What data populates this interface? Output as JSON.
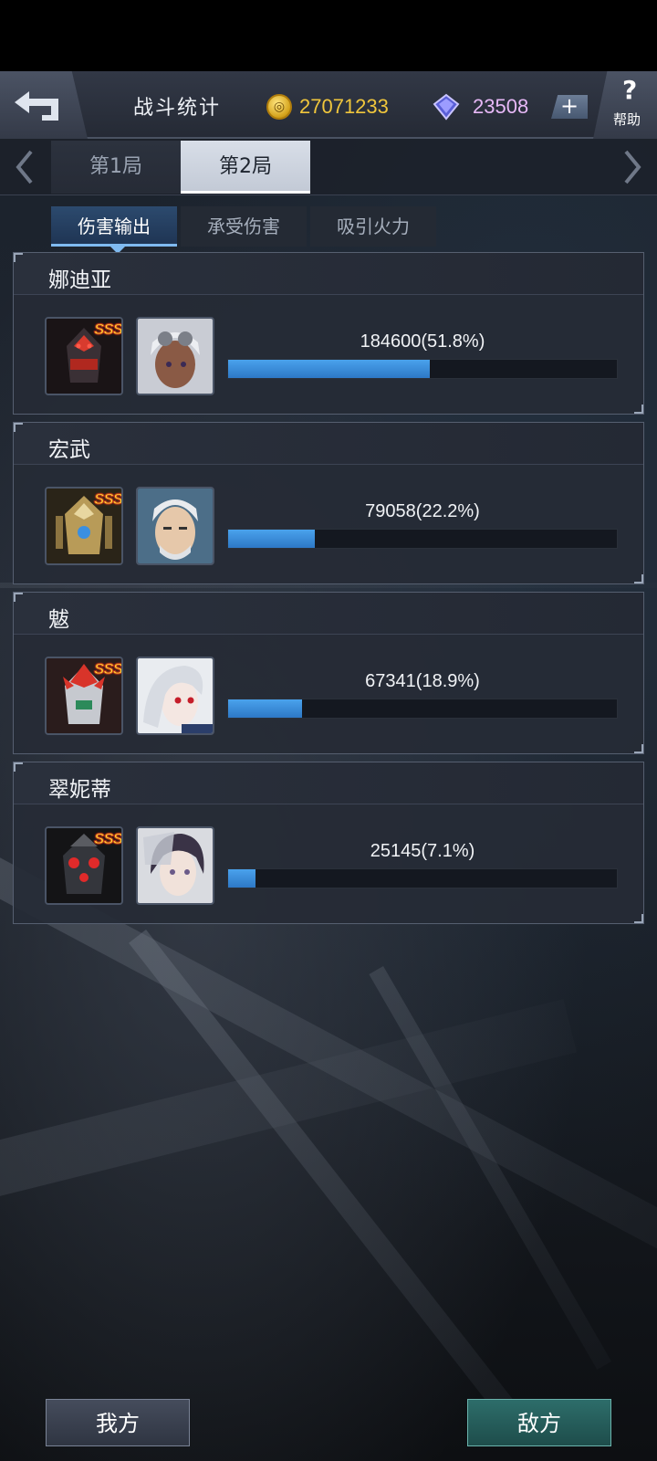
{
  "header": {
    "title": "战斗统计",
    "coins": "27071233",
    "gems": "23508",
    "coin_icon": "coin-icon",
    "gem_icon": "gem-icon",
    "plus_label": "+",
    "help_label": "帮助"
  },
  "round_tabs": [
    {
      "label": "第1局",
      "active": false
    },
    {
      "label": "第2局",
      "active": true
    }
  ],
  "stat_tabs": [
    {
      "label": "伤害输出",
      "active": true
    },
    {
      "label": "承受伤害",
      "active": false
    },
    {
      "label": "吸引火力",
      "active": false
    }
  ],
  "entries": [
    {
      "name": "娜迪亚",
      "rank": "SSS",
      "value_text": "184600(51.8%)",
      "percent": 51.8
    },
    {
      "name": "宏武",
      "rank": "SSS",
      "value_text": "79058(22.2%)",
      "percent": 22.2
    },
    {
      "name": "魃",
      "rank": "SSS",
      "value_text": "67341(18.9%)",
      "percent": 18.9
    },
    {
      "name": "翠妮蒂",
      "rank": "SSS",
      "value_text": "25145(7.1%)",
      "percent": 7.1
    }
  ],
  "footer": {
    "our_side": "我方",
    "enemy_side": "敌方"
  },
  "colors": {
    "accent_blue": "#3a8fe0",
    "coin_gold": "#f0c63c",
    "gem_pink": "#e7b8f7",
    "enemy_button": "#2d6d6a"
  }
}
